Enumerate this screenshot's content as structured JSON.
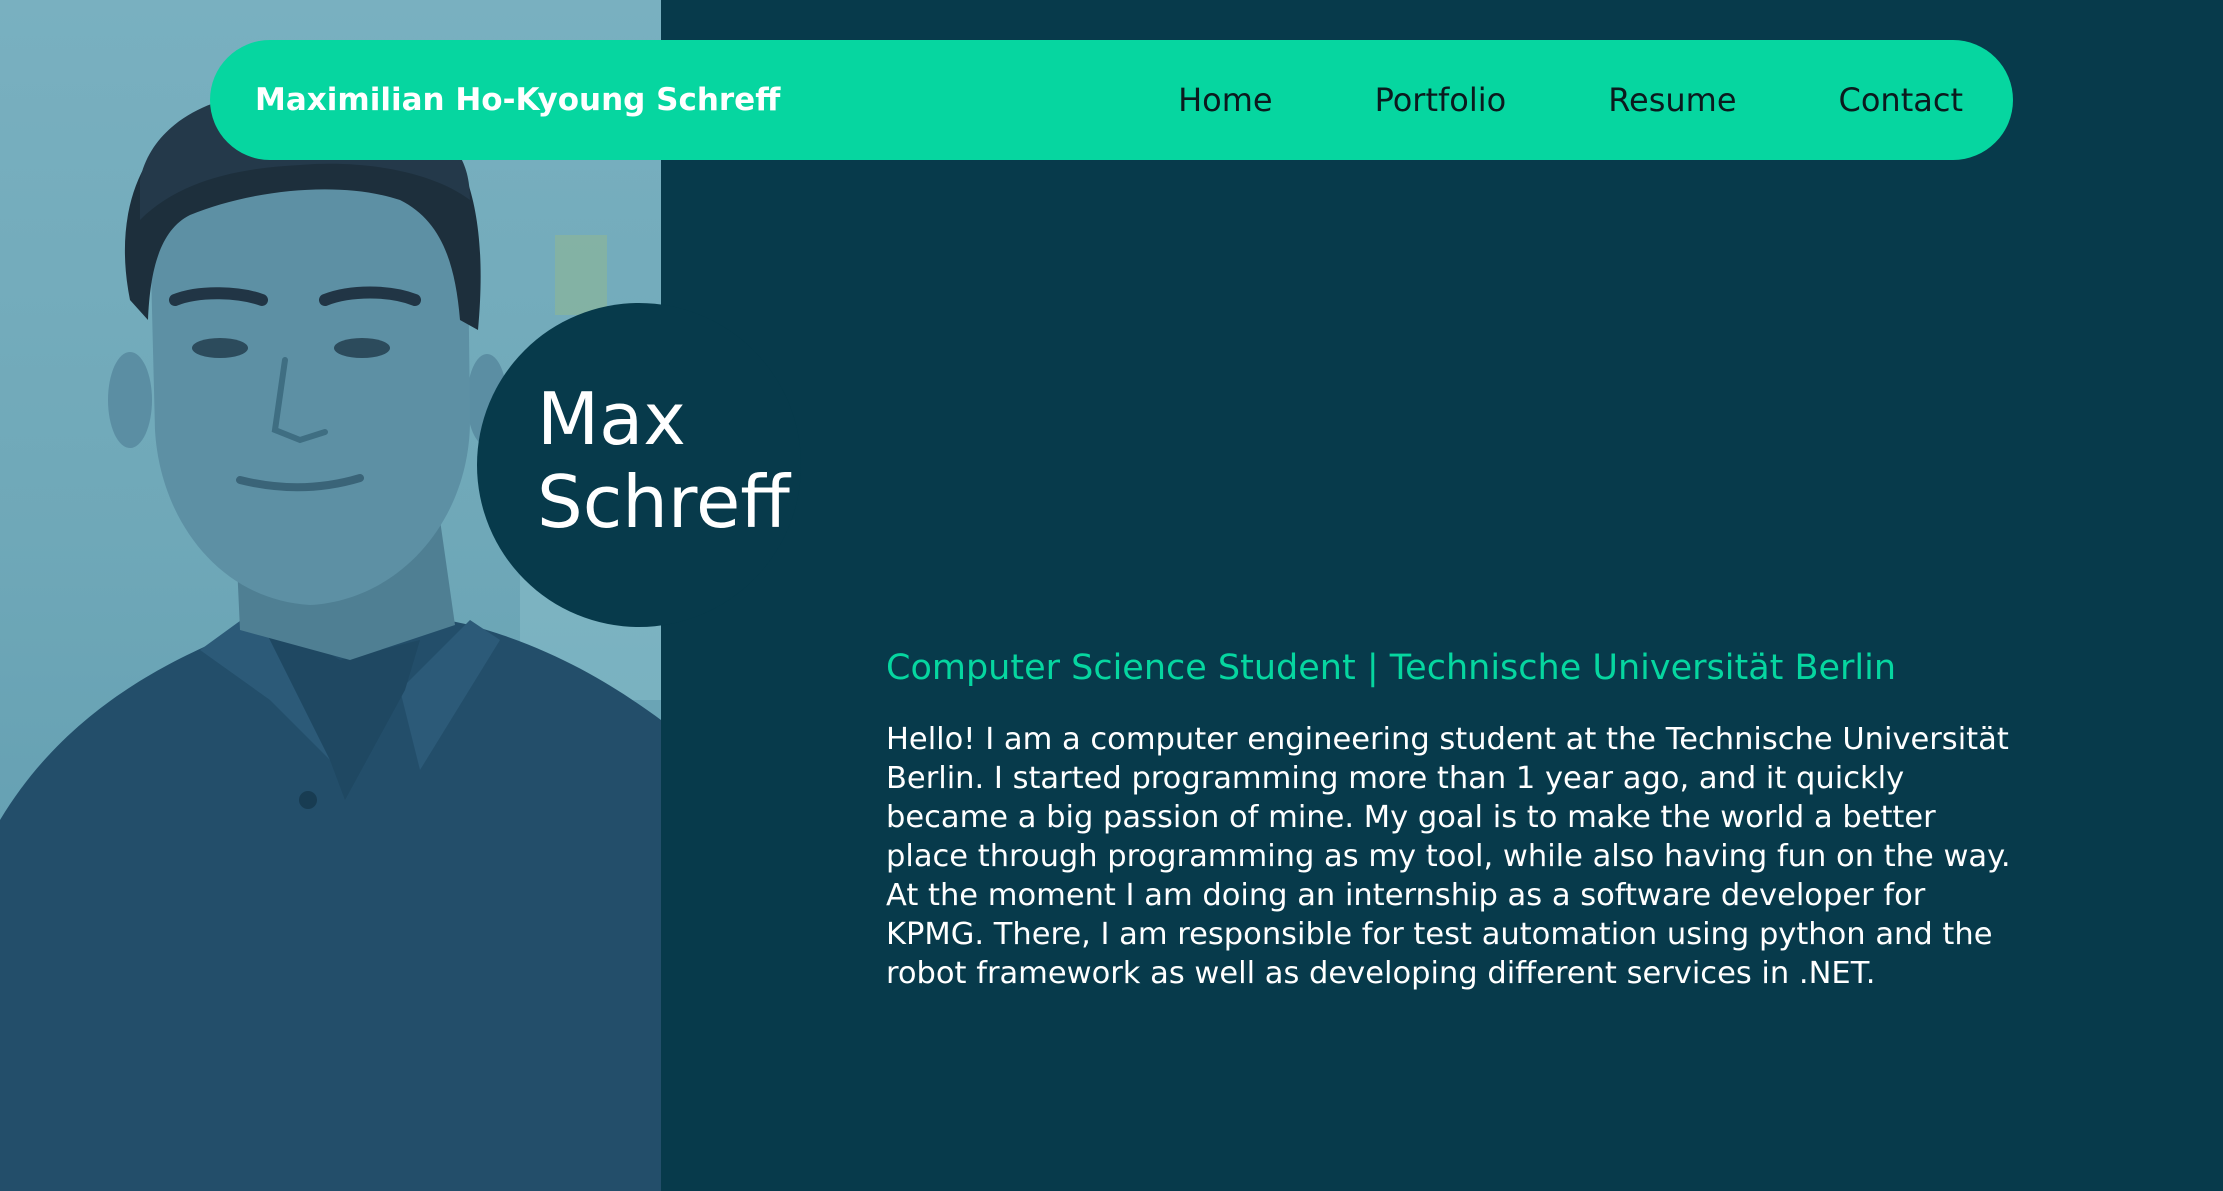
{
  "navbar": {
    "brand": "Maximilian Ho-Kyoung Schreff",
    "links": [
      "Home",
      "Portfolio",
      "Resume",
      "Contact"
    ]
  },
  "hero": {
    "first_name": "Max",
    "last_name": "Schreff"
  },
  "about": {
    "subtitle": "Computer Science Student | Technische Universität Berlin",
    "paragraph_1": "Hello! I am a computer engineering student at the Technische Universität Berlin. I started programming more than 1 year ago, and it quickly became a big passion of mine. My goal is to make the world a better place through programming as my tool, while also having fun on the way.",
    "paragraph_2": "At the moment I am doing an internship as a software developer for KPMG. There, I am responsible for test automation using python and the robot framework as well as developing different services in .NET."
  },
  "colors": {
    "background": "#073a4b",
    "accent": "#06d6a0",
    "text": "#ffffff",
    "nav_text": "#0b1a1e"
  }
}
